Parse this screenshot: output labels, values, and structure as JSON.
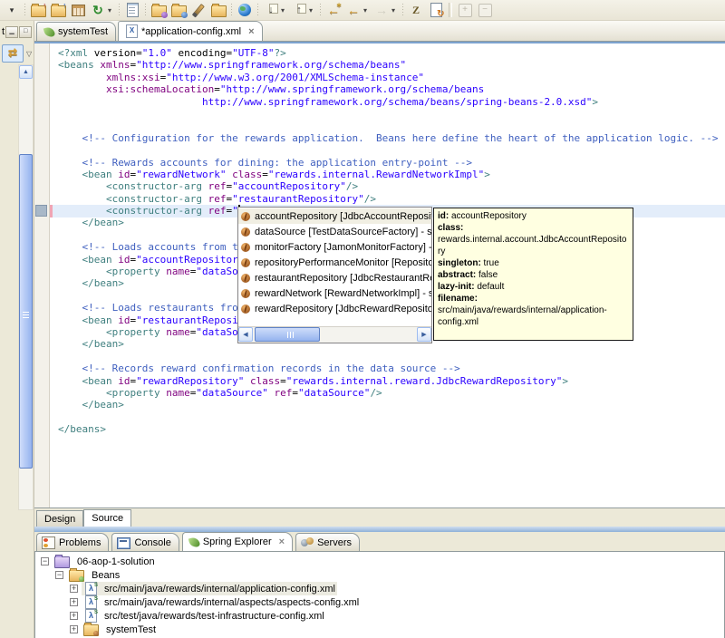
{
  "accent_colors": {
    "toolbar_bg": "#ece9d8",
    "focus_line": "#7da3cf",
    "tooltip_bg": "#ffffe1",
    "selection_line": "#e3edfa",
    "tag": "#3f7f7f",
    "attr": "#7f007f",
    "value": "#2a00ff",
    "comment": "#3f5fbf"
  },
  "toolbar": {
    "items": [
      {
        "type": "icon",
        "name": "toolbar-overflow-chevron-icon",
        "cls": "g-chev",
        "glyph": "▾"
      },
      {
        "type": "sep"
      },
      {
        "type": "icon",
        "name": "new-wizard-up-icon",
        "cls": "ic-folder-up"
      },
      {
        "type": "icon",
        "name": "new-wizard-up2-icon",
        "cls": "ic-folder-up2"
      },
      {
        "type": "icon",
        "name": "table-icon",
        "cls": "ic-grid"
      },
      {
        "type": "icon",
        "name": "refresh-icon",
        "cls": "g-refresh",
        "glyph": "↻",
        "chev": true
      },
      {
        "type": "sep"
      },
      {
        "type": "icon",
        "name": "editor-doc-icon",
        "cls": "ic-doc"
      },
      {
        "type": "sep"
      },
      {
        "type": "icon",
        "name": "open-folder-purple-icon",
        "cls": "ic-folder-purple"
      },
      {
        "type": "icon",
        "name": "open-folder-blue-icon",
        "cls": "ic-folder-blue"
      },
      {
        "type": "icon",
        "name": "paintbrush-icon",
        "cls": "ic-brush"
      },
      {
        "type": "icon",
        "name": "folder-icon",
        "cls": "ic-folder"
      },
      {
        "type": "sep"
      },
      {
        "type": "icon",
        "name": "web-browser-globe-icon",
        "cls": "ic-globe"
      },
      {
        "type": "sep"
      },
      {
        "type": "icon",
        "name": "next-annotation-icon",
        "cls": "g-ann",
        "glyph": "↓",
        "chev": true
      },
      {
        "type": "icon",
        "name": "prev-annotation-icon",
        "cls": "g-ann",
        "glyph": "↑",
        "chev": true
      },
      {
        "type": "sep"
      },
      {
        "type": "icon",
        "name": "last-edit-location-icon",
        "cls": "g-arrow-gold g-star",
        "glyph": "←"
      },
      {
        "type": "icon",
        "name": "back-icon",
        "cls": "g-arrow-gold",
        "glyph": "←",
        "chev": true
      },
      {
        "type": "icon",
        "name": "forward-icon",
        "cls": "g-arrow-gray",
        "glyph": "→",
        "chev": true,
        "disabled": true
      },
      {
        "type": "sep"
      },
      {
        "type": "icon",
        "name": "stamp-icon",
        "cls": "g-stamp",
        "glyph": "Z"
      },
      {
        "type": "icon",
        "name": "refresh-file-icon",
        "cls": "ic-doc-refresh"
      },
      {
        "type": "bar"
      },
      {
        "type": "icon",
        "name": "expand-all-icon",
        "cls": "g-boxed",
        "glyph": "+",
        "disabled": true
      },
      {
        "type": "icon",
        "name": "collapse-all-icon",
        "cls": "g-boxed",
        "glyph": "−",
        "disabled": true
      }
    ]
  },
  "left_strip": {
    "tab_fragment": "t",
    "minimize_glyph": "▁",
    "maximize_glyph": "□",
    "link_editor_glyph": "⇄",
    "menu_chevron": "▽",
    "scroll_up_glyph": "▲"
  },
  "editor": {
    "tabs": [
      {
        "label": "systemTest",
        "icon": "spring-leaf-icon",
        "active": false,
        "closable": false
      },
      {
        "label": "*application-config.xml",
        "icon": "xml-file-icon",
        "active": true,
        "closable": true,
        "close_glyph": "×"
      }
    ],
    "view_switch_tabs": [
      {
        "label": "Design",
        "active": false
      },
      {
        "label": "Source",
        "active": true
      }
    ],
    "current_line_index": 13,
    "code_lines": [
      [
        [
          "tag",
          "<?xml "
        ],
        [
          "plain",
          "version="
        ],
        [
          "val",
          "\"1.0\""
        ],
        [
          "plain",
          " encoding="
        ],
        [
          "val",
          "\"UTF-8\""
        ],
        [
          "tag",
          "?>"
        ]
      ],
      [
        [
          "tag",
          "<beans "
        ],
        [
          "attr",
          "xmlns"
        ],
        [
          "plain",
          "="
        ],
        [
          "val",
          "\"http://www.springframework.org/schema/beans\""
        ]
      ],
      [
        [
          "plain",
          "        "
        ],
        [
          "attr",
          "xmlns:xsi"
        ],
        [
          "plain",
          "="
        ],
        [
          "val",
          "\"http://www.w3.org/2001/XMLSchema-instance\""
        ]
      ],
      [
        [
          "plain",
          "        "
        ],
        [
          "attr",
          "xsi:schemaLocation"
        ],
        [
          "plain",
          "="
        ],
        [
          "val",
          "\"http://www.springframework.org/schema/beans"
        ]
      ],
      [
        [
          "plain",
          "                        "
        ],
        [
          "val",
          "http://www.springframework.org/schema/beans/spring-beans-2.0.xsd\""
        ],
        [
          "tag",
          ">"
        ]
      ],
      [],
      [],
      [
        [
          "plain",
          "    "
        ],
        [
          "com",
          "<!-- Configuration for the rewards application.  Beans here define the heart of the application logic. -->"
        ]
      ],
      [],
      [
        [
          "plain",
          "    "
        ],
        [
          "com",
          "<!-- Rewards accounts for dining: the application entry-point -->"
        ]
      ],
      [
        [
          "plain",
          "    "
        ],
        [
          "tag",
          "<bean "
        ],
        [
          "attr",
          "id"
        ],
        [
          "plain",
          "="
        ],
        [
          "val",
          "\"rewardNetwork\""
        ],
        [
          "plain",
          " "
        ],
        [
          "attr",
          "class"
        ],
        [
          "plain",
          "="
        ],
        [
          "val",
          "\"rewards.internal.RewardNetworkImpl\""
        ],
        [
          "tag",
          ">"
        ]
      ],
      [
        [
          "plain",
          "        "
        ],
        [
          "tag",
          "<constructor-arg "
        ],
        [
          "attr",
          "ref"
        ],
        [
          "plain",
          "="
        ],
        [
          "val",
          "\"accountRepository\""
        ],
        [
          "tag",
          "/>"
        ]
      ],
      [
        [
          "plain",
          "        "
        ],
        [
          "tag",
          "<constructor-arg "
        ],
        [
          "attr",
          "ref"
        ],
        [
          "plain",
          "="
        ],
        [
          "val",
          "\"restaurantRepository\""
        ],
        [
          "tag",
          "/>"
        ]
      ],
      [
        [
          "plain",
          "        "
        ],
        [
          "tag",
          "<constructor-arg "
        ],
        [
          "attr",
          "ref"
        ],
        [
          "plain",
          "="
        ],
        [
          "val",
          "\""
        ],
        [
          "CUR",
          ""
        ],
        [
          "val",
          "\""
        ],
        [
          "tag",
          "/>"
        ]
      ],
      [
        [
          "plain",
          "    "
        ],
        [
          "tag",
          "</bean>"
        ]
      ],
      [],
      [
        [
          "plain",
          "    "
        ],
        [
          "com",
          "<!-- Loads accounts from t"
        ]
      ],
      [
        [
          "plain",
          "    "
        ],
        [
          "tag",
          "<bean "
        ],
        [
          "attr",
          "id"
        ],
        [
          "plain",
          "="
        ],
        [
          "val",
          "\"accountRepositor"
        ]
      ],
      [
        [
          "plain",
          "        "
        ],
        [
          "tag",
          "<property "
        ],
        [
          "attr",
          "name"
        ],
        [
          "plain",
          "="
        ],
        [
          "val",
          "\"dataSo"
        ]
      ],
      [
        [
          "plain",
          "    "
        ],
        [
          "tag",
          "</bean>"
        ]
      ],
      [],
      [
        [
          "plain",
          "    "
        ],
        [
          "com",
          "<!-- Loads restaurants fro"
        ]
      ],
      [
        [
          "plain",
          "    "
        ],
        [
          "tag",
          "<bean "
        ],
        [
          "attr",
          "id"
        ],
        [
          "plain",
          "="
        ],
        [
          "val",
          "\"restaurantReposi"
        ]
      ],
      [
        [
          "plain",
          "        "
        ],
        [
          "tag",
          "<property "
        ],
        [
          "attr",
          "name"
        ],
        [
          "plain",
          "="
        ],
        [
          "val",
          "\"dataSo"
        ]
      ],
      [
        [
          "plain",
          "    "
        ],
        [
          "tag",
          "</bean>"
        ]
      ],
      [],
      [
        [
          "plain",
          "    "
        ],
        [
          "com",
          "<!-- Records reward confirmation records in the data source -->"
        ]
      ],
      [
        [
          "plain",
          "    "
        ],
        [
          "tag",
          "<bean "
        ],
        [
          "attr",
          "id"
        ],
        [
          "plain",
          "="
        ],
        [
          "val",
          "\"rewardRepository\""
        ],
        [
          "plain",
          " "
        ],
        [
          "attr",
          "class"
        ],
        [
          "plain",
          "="
        ],
        [
          "val",
          "\"rewards.internal.reward.JdbcRewardRepository\""
        ],
        [
          "tag",
          ">"
        ]
      ],
      [
        [
          "plain",
          "        "
        ],
        [
          "tag",
          "<property "
        ],
        [
          "attr",
          "name"
        ],
        [
          "plain",
          "="
        ],
        [
          "val",
          "\"dataSource\""
        ],
        [
          "plain",
          " "
        ],
        [
          "attr",
          "ref"
        ],
        [
          "plain",
          "="
        ],
        [
          "val",
          "\"dataSource\""
        ],
        [
          "tag",
          "/>"
        ]
      ],
      [
        [
          "plain",
          "    "
        ],
        [
          "tag",
          "</bean>"
        ]
      ],
      [],
      [
        [
          "tag",
          "</beans>"
        ]
      ]
    ]
  },
  "completion": {
    "items": [
      {
        "label": "accountRepository [JdbcAccountRepository] - src",
        "selected": true
      },
      {
        "label": "dataSource [TestDataSourceFactory] - src/test/ja",
        "selected": false
      },
      {
        "label": "monitorFactory [JamonMonitorFactory] - src/main",
        "selected": false
      },
      {
        "label": "repositoryPerformanceMonitor [RepositoryPerfor",
        "selected": false
      },
      {
        "label": "restaurantRepository [JdbcRestaurantRepository",
        "selected": false
      },
      {
        "label": "rewardNetwork [RewardNetworkImpl] - src/main/j",
        "selected": false
      },
      {
        "label": "rewardRepository [JdbcRewardRepository] - src/r",
        "selected": false
      }
    ],
    "scroll_left_glyph": "◀",
    "scroll_right_glyph": "▶"
  },
  "tooltip": {
    "fields": [
      {
        "label": "id:",
        "value": " accountRepository"
      },
      {
        "label": "class:",
        "value": " rewards.internal.account.JdbcAccountRepository"
      },
      {
        "label": "singleton:",
        "value": " true"
      },
      {
        "label": "abstract:",
        "value": " false"
      },
      {
        "label": "lazy-init:",
        "value": " default"
      },
      {
        "label": "filename:",
        "value": " src/main/java/rewards/internal/application-config.xml"
      }
    ]
  },
  "bottom_panel": {
    "tabs": [
      {
        "label": "Problems",
        "icon": "problems-icon",
        "active": false,
        "closable": false
      },
      {
        "label": "Console",
        "icon": "console-icon",
        "active": false,
        "closable": false
      },
      {
        "label": "Spring Explorer",
        "icon": "spring-leaf-icon",
        "active": true,
        "closable": true,
        "close_glyph": "×"
      },
      {
        "label": "Servers",
        "icon": "servers-icon",
        "active": false,
        "closable": false
      }
    ],
    "tree_items": [
      {
        "indent": 0,
        "expand": "−",
        "icon": "project-icon",
        "label": "06-aop-1-solution",
        "selected": false
      },
      {
        "indent": 1,
        "expand": "−",
        "icon": "beans-folder-icon",
        "label": "Beans",
        "selected": false
      },
      {
        "indent": 2,
        "expand": "+",
        "icon": "spring-config-icon",
        "label": "src/main/java/rewards/internal/application-config.xml",
        "selected": true
      },
      {
        "indent": 2,
        "expand": "+",
        "icon": "spring-config-icon",
        "label": "src/main/java/rewards/internal/aspects/aspects-config.xml",
        "selected": false
      },
      {
        "indent": 2,
        "expand": "+",
        "icon": "spring-config-icon",
        "label": "src/test/java/rewards/test-infrastructure-config.xml",
        "selected": false
      },
      {
        "indent": 2,
        "expand": "+",
        "icon": "beans-set-icon",
        "label": "systemTest",
        "selected": false
      }
    ]
  }
}
